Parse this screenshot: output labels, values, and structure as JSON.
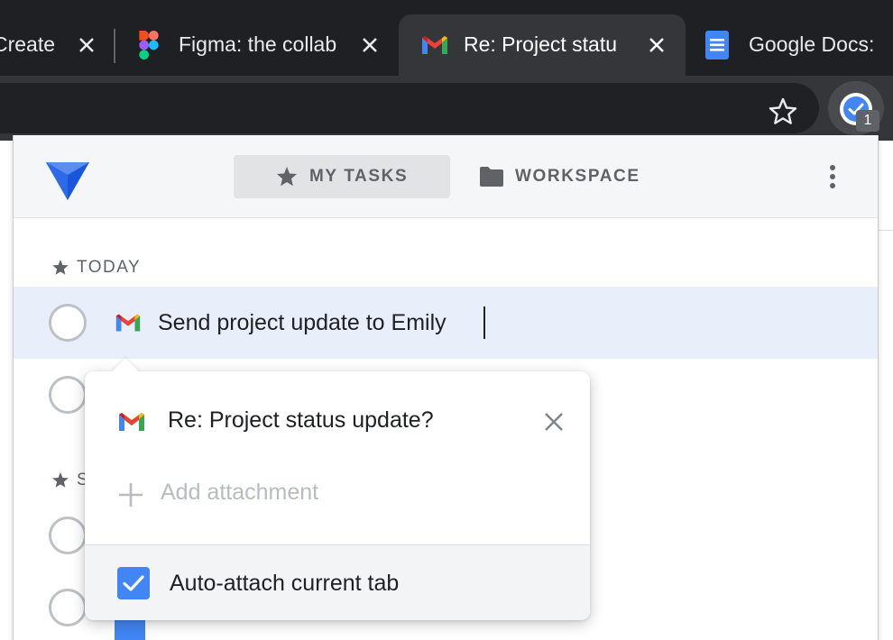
{
  "browser": {
    "tabs": [
      {
        "title": "Create",
        "favicon": "create-icon"
      },
      {
        "title": "Figma: the collab",
        "favicon": "figma-icon"
      },
      {
        "title": "Re: Project statu",
        "favicon": "gmail-icon",
        "active": true
      },
      {
        "title": "Google Docs:",
        "favicon": "google-docs-icon"
      }
    ],
    "extension_badge": "1"
  },
  "app": {
    "nav": {
      "my_tasks": "MY TASKS",
      "workspace": "WORKSPACE"
    },
    "sections": {
      "today": "TODAY",
      "second_initial": "S"
    },
    "tasks": [
      {
        "title": "Send project update to Emily",
        "source_icon": "gmail-icon",
        "selected": true
      }
    ],
    "attachment_card": {
      "email_title": "Re: Project status update?",
      "add_attachment": "Add attachment",
      "auto_attach_label": "Auto-attach current tab",
      "auto_attach_checked": true
    }
  },
  "colors": {
    "accent_blue": "#4285f4",
    "tab_strip": "#1f2023",
    "active_tab": "#35363a",
    "selected_row": "#e8eefa"
  }
}
